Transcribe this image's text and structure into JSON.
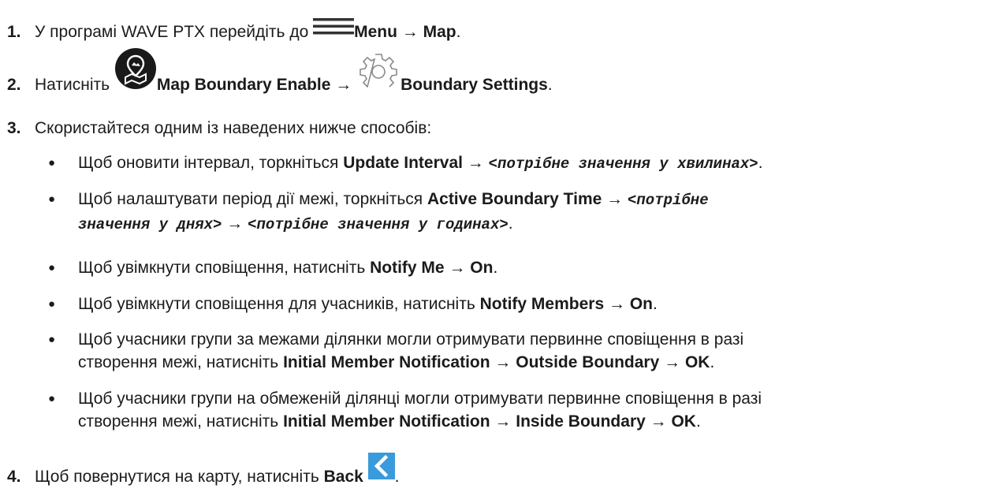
{
  "steps": {
    "s1": {
      "number": "1.",
      "before": "У програмі WAVE PTX перейдіть до ",
      "menu": "Menu",
      "arrow": " → ",
      "map": "Map",
      "end": "."
    },
    "s2": {
      "number": "2.",
      "before": "Натисніть ",
      "map_boundary_enable": "Map Boundary Enable",
      "arrow": " → ",
      "boundary_settings": "Boundary Settings",
      "end": "."
    },
    "s3": {
      "number": "3.",
      "text": "Скористайтеся одним із наведених нижче способів:"
    },
    "s4": {
      "number": "4.",
      "before": "Щоб повернутися на карту, натисніть ",
      "back": "Back",
      "end": "."
    }
  },
  "bullets": {
    "b1": {
      "marker": "●",
      "before": "Щоб оновити інтервал, торкніться ",
      "update_interval": "Update Interval",
      "arrow": " → ",
      "value": "<потрібне значення у хвилинах>",
      "end": "."
    },
    "b2": {
      "marker": "●",
      "before": "Щоб налаштувати період дії межі, торкніться ",
      "active_boundary_time": "Active Boundary Time",
      "arrow": " → ",
      "value_days_part1": "<потрібне",
      "value_days_part2": "значення у днях>",
      "arrow2": " → ",
      "value_hours": "<потрібне значення у годинах>",
      "end": "."
    },
    "b3": {
      "marker": "●",
      "before": "Щоб увімкнути сповіщення, натисніть ",
      "notify_me": "Notify Me",
      "arrow": " → ",
      "on": "On",
      "end": "."
    },
    "b4": {
      "marker": "●",
      "before": "Щоб увімкнути сповіщення для учасників, натисніть ",
      "notify_members": "Notify Members",
      "arrow": " → ",
      "on": "On",
      "end": "."
    },
    "b5": {
      "marker": "●",
      "line1": "Щоб учасники групи за межами ділянки могли отримувати первинне сповіщення в разі",
      "before": "створення межі, натисніть ",
      "initial_member_notification": "Initial Member Notification",
      "arrow": " → ",
      "outside_boundary": "Outside Boundary",
      "arrow2": " → ",
      "ok": "OK",
      "end": "."
    },
    "b6": {
      "marker": "●",
      "line1": "Щоб учасники групи на обмеженій ділянці могли отримувати первинне сповіщення в разі",
      "before": "створення межі, натисніть ",
      "initial_member_notification": "Initial Member Notification",
      "arrow": " → ",
      "inside_boundary": "Inside Boundary",
      "arrow2": " → ",
      "ok": "OK",
      "end": "."
    }
  },
  "icons": {
    "menu": "hamburger-menu-icon",
    "map_boundary": "map-boundary-icon",
    "settings": "gear-icon",
    "back": "back-chevron-icon"
  },
  "colors": {
    "text": "#1b1b1b",
    "menu_icon": "#333333",
    "map_icon_bg": "#1a1a1a",
    "gear_icon": "#8a8a8a",
    "back_icon_bg": "#3a9bdc"
  }
}
